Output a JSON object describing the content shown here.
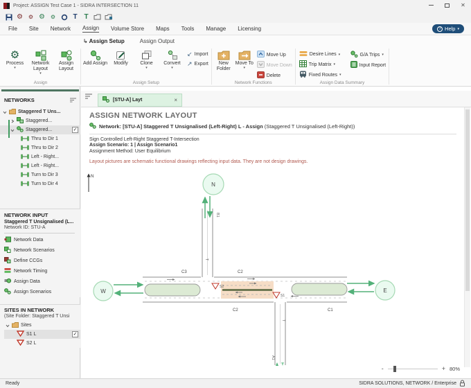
{
  "window": {
    "title": "Project: ASSIGN Test Case 1  -  SIDRA INTERSECTION 11"
  },
  "menubar": {
    "items": [
      "File",
      "Site",
      "Network",
      "Assign",
      "Volume Store",
      "Maps",
      "Tools",
      "Manage",
      "Licensing"
    ],
    "active_item": "Assign",
    "help_label": "Help"
  },
  "ribbon": {
    "tab_setup": "Assign Setup",
    "tab_output": "Assign Output",
    "groups": {
      "assign": "Assign",
      "assign_setup": "Assign Setup",
      "network_functions": "Network Functions",
      "assign_data_summary": "Assign Data Summary"
    },
    "buttons": {
      "process": "Process",
      "network_layout": "Network Layout",
      "assign_layout": "Assign Layout",
      "add_assign": "Add Assign",
      "modify": "Modify",
      "clone": "Clone",
      "convert": "Convert",
      "import": "Import",
      "export": "Export",
      "new_folder": "New Folder",
      "move_to": "Move To",
      "move_up": "Move Up",
      "move_down": "Move Down",
      "delete": "Delete",
      "desire_lines": "Desire Lines",
      "trip_matrix": "Trip Matrix",
      "fixed_routes": "Fixed Routes",
      "ga_trips": "G/A Trips",
      "input_report": "Input Report"
    }
  },
  "networks_panel": {
    "title": "NETWORKS",
    "root": "Staggered T Uns...",
    "network_child": "Staggered...",
    "assign_child": "Staggered...",
    "routes": [
      "Thru to Dir 1",
      "Thru to Dir 2",
      "Left - Right...",
      "Left - Right...",
      "Turn to Dir 3",
      "Turn to Dir 4"
    ]
  },
  "network_input_panel": {
    "title": "NETWORK INPUT",
    "name": "Staggered T Unsignalised (L...",
    "id_line": "Network ID: STU-A",
    "items": [
      "Network Data",
      "Network Scenarios",
      "Define CCGs",
      "Network Timing",
      "Assign Data",
      "Assign Scenarios"
    ]
  },
  "sites_panel": {
    "title": "SITES IN NETWORK",
    "subtitle": "(Site Folder: Staggered T Unsi",
    "folder": "Sites",
    "site1": "S1 L",
    "site2": "S2 L"
  },
  "document": {
    "tab_label": "[STU-A] Layt",
    "heading": "ASSIGN NETWORK LAYOUT",
    "network_bold": "Network: [STU-A] Staggered T Unsignalised (Left-Right) L - Assign",
    "network_paren": " (Staggered T Unsignalised (Left-Right))",
    "line1": "Sign Controlled Left-Right Staggered T-Intersection",
    "line2": "Assign Scenario: 1 | Assign Scenario1",
    "line3": "Assignment Method: User Equilibrium",
    "disclaimer": "Layout pictures are schematic functional drawings reflecting input data. They are not design drawings."
  },
  "diagram": {
    "compass": "N",
    "node_n": "N",
    "node_w": "W",
    "node_e": "E",
    "label_c3": "C3",
    "label_c2_upper": "C2",
    "label_c2_lower": "C2",
    "label_c1": "C1",
    "label_b1": "B1",
    "label_a1": "A1",
    "label_t_north": "T",
    "label_t_south": "T",
    "sign_s1": "S1",
    "sign_s2": "S2"
  },
  "zoom_control": {
    "minus": "-",
    "plus": "+",
    "value": "80%"
  },
  "statusbar": {
    "left": "Ready",
    "right": "SIDRA SOLUTIONS, NETWORK / Enterprise"
  },
  "glyphs": {
    "dropdown": "▾",
    "close": "×",
    "check": "✓",
    "tab_arrow": "↳",
    "import_arrow": "↙",
    "export_arrow": "↗"
  },
  "colors": {
    "accent_green": "#217346",
    "tab_bg": "#ddf2e2",
    "disclaimer_red": "#b0584e",
    "help_blue": "#1f4e79"
  }
}
